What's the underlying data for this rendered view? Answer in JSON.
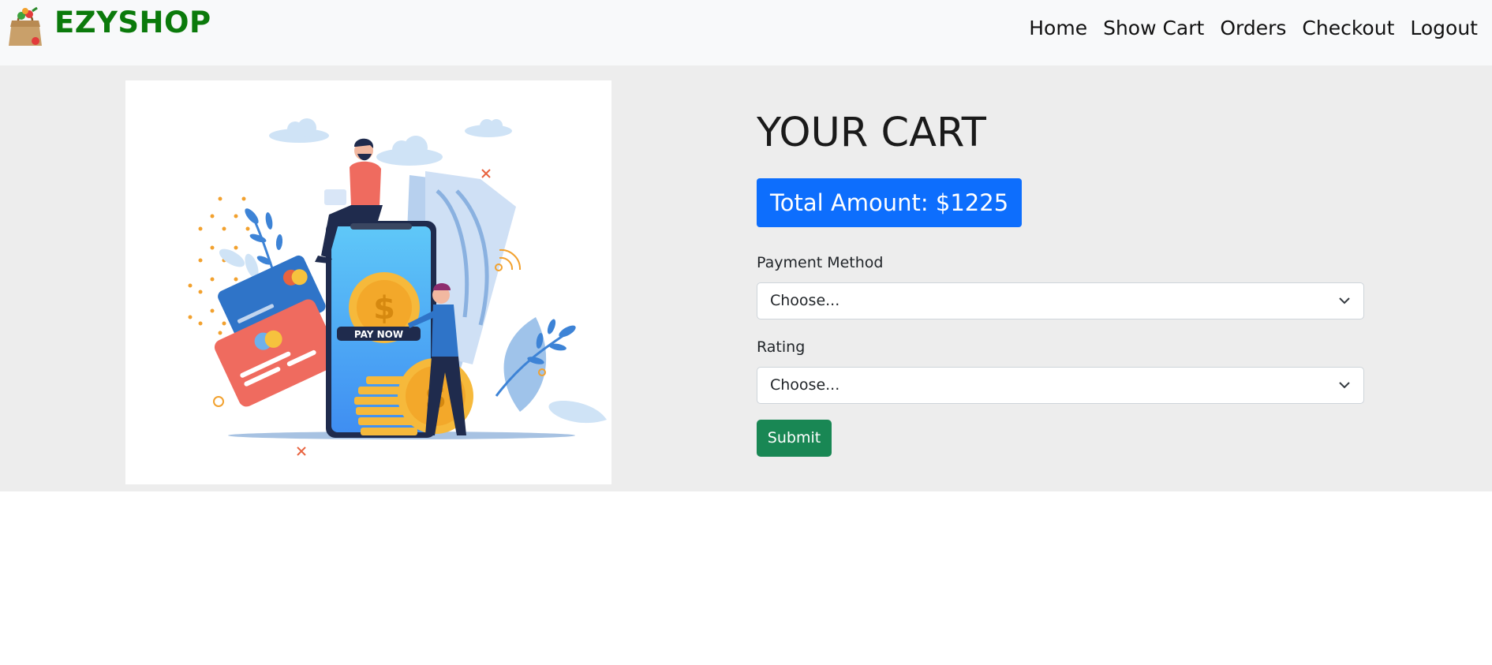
{
  "navbar": {
    "brand": "EZYSHOP",
    "brand_color": "#0b7a0b",
    "logo_icon": "shopping-bag-icon",
    "links": [
      {
        "label": "Home"
      },
      {
        "label": "Show Cart"
      },
      {
        "label": "Orders"
      },
      {
        "label": "Checkout"
      },
      {
        "label": "Logout"
      }
    ]
  },
  "illustration": {
    "pay_button_text": "PAY NOW",
    "description_icon": "mobile-payment-illustration"
  },
  "cart": {
    "title": "YOUR CART",
    "total_label": "Total Amount: $1225",
    "payment_label": "Payment Method",
    "payment_value": "Choose...",
    "rating_label": "Rating",
    "rating_value": "Choose...",
    "submit_label": "Submit"
  },
  "colors": {
    "primary": "#0d6efd",
    "success": "#198754",
    "navbar_bg": "#f8f9fa",
    "hero_bg": "#ededed"
  }
}
